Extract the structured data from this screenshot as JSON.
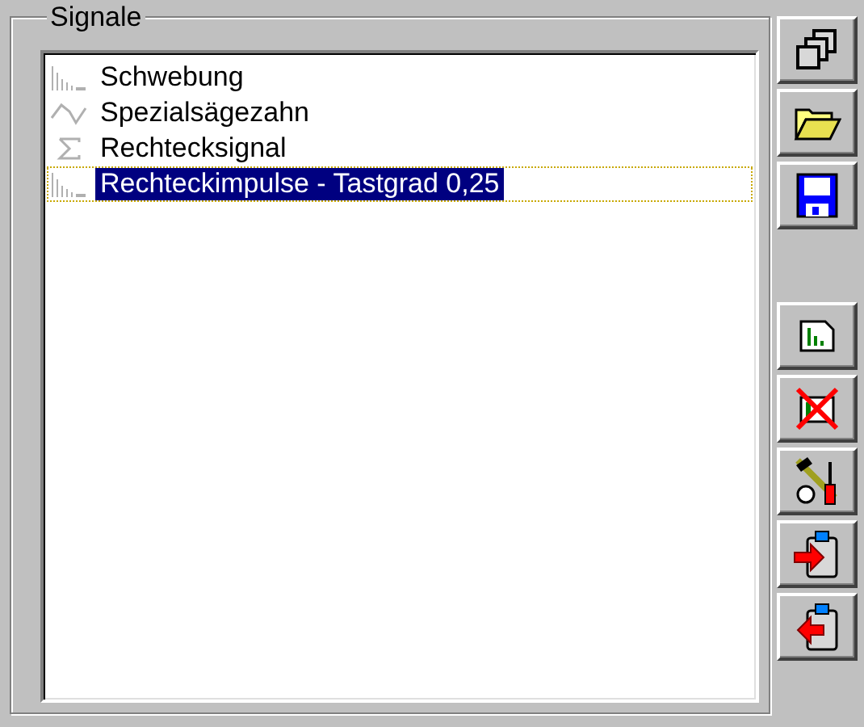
{
  "group": {
    "title": "Signale"
  },
  "signals": [
    {
      "label": "Schwebung",
      "kind": "spectrum",
      "selected": false
    },
    {
      "label": "Spezialsägezahn",
      "kind": "wave",
      "selected": false
    },
    {
      "label": "Rechtecksignal",
      "kind": "sum",
      "selected": false
    },
    {
      "label": "Rechteckimpulse - Tastgrad 0,25",
      "kind": "spectrum",
      "selected": true
    }
  ],
  "file_buttons": [
    {
      "kind": "copy"
    },
    {
      "kind": "open"
    },
    {
      "kind": "save"
    }
  ],
  "signal_buttons": [
    {
      "kind": "new"
    },
    {
      "kind": "delete"
    },
    {
      "kind": "tools"
    },
    {
      "kind": "import"
    },
    {
      "kind": "export"
    }
  ]
}
